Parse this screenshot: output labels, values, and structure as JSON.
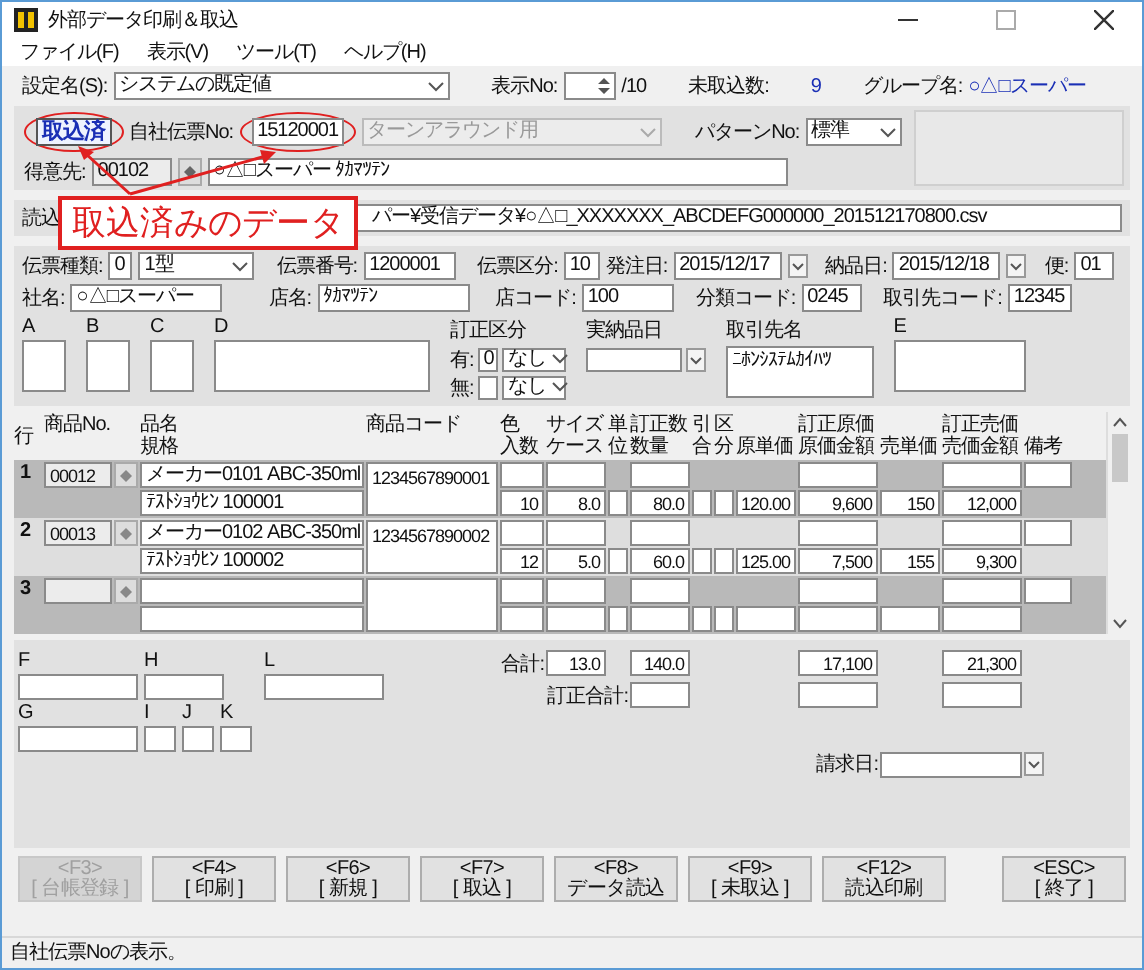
{
  "window": {
    "title": "外部データ印刷＆取込"
  },
  "menu": [
    {
      "label": "ファイル(F)"
    },
    {
      "label": "表示(V)"
    },
    {
      "label": "ツール(T)"
    },
    {
      "label": "ヘルプ(H)"
    }
  ],
  "settings": {
    "label": "設定名(S):",
    "value": "システムの既定値",
    "display_no_label": "表示No:",
    "display_no_total": "/10",
    "pending_label": "未取込数:",
    "pending_value": "9",
    "group_label": "グループ名:",
    "group_value": "○△□スーパー"
  },
  "slip": {
    "status_badge": "取込済",
    "own_no_label": "自社伝票No:",
    "own_no": "15120001",
    "turnaround": "ターンアラウンド用",
    "pattern_label": "パターンNo:",
    "pattern": "標準",
    "customer_label": "得意先:",
    "customer_code": "00102",
    "customer_name": "○△□スーパー ﾀｶﾏﾂﾃﾝ"
  },
  "annotation": {
    "text": "取込済みのデータ"
  },
  "read_file": {
    "label": "読込",
    "path": "パー¥受信データ¥○△□_XXXXXXX_ABCDEFG000000_201512170800.csv"
  },
  "header": {
    "slip_type_label": "伝票種類:",
    "slip_type_code": "0",
    "slip_type": "1型",
    "slip_no_label": "伝票番号:",
    "slip_no": "1200001",
    "slip_class_label": "伝票区分:",
    "slip_class": "10",
    "order_date_label": "発注日:",
    "order_date": "2015/12/17",
    "delivery_date_label": "納品日:",
    "delivery_date": "2015/12/18",
    "flight_label": "便:",
    "flight": "01",
    "company_label": "社名:",
    "company": "○△□スーパー",
    "store_label": "店名:",
    "store": "ﾀｶﾏﾂﾃﾝ",
    "store_code_label": "店コード:",
    "store_code": "100",
    "category_code_label": "分類コード:",
    "category_code": "0245",
    "supplier_code_label": "取引先コード:",
    "supplier_code": "12345"
  },
  "free_boxes": [
    {
      "label": "A",
      "kind": "small"
    },
    {
      "label": "B",
      "kind": "small"
    },
    {
      "label": "C",
      "kind": "small"
    },
    {
      "label": "D",
      "kind": "wide"
    }
  ],
  "correction": {
    "title": "訂正区分",
    "yes_label": "有:",
    "yes_code": "0",
    "yes_value": "なし",
    "no_label": "無:",
    "no_value": "なし"
  },
  "actual_delivery": {
    "title": "実納品日"
  },
  "supplier_name": {
    "title": "取引先名",
    "value": "ﾆﾎﾝｼｽﾃﾑｶｲﾊﾂ"
  },
  "box_e": {
    "label": "E"
  },
  "columns": {
    "line": "行",
    "product_no": "商品No.",
    "name": "品名",
    "spec": "規格",
    "code": "商品コード",
    "col_color": "色",
    "size": "サイズ",
    "pack": "入数",
    "case": "ケース",
    "unit": "単位",
    "corrected_qty": "訂正数",
    "qty": "数量",
    "hikiai": "引合",
    "kubun": "区分",
    "cost_unit": "原単価",
    "corrected_cost": "訂正原価",
    "cost_amount": "原価金額",
    "price_unit": "売単価",
    "corrected_price": "訂正売価",
    "price_amount": "売価金額",
    "note": "備考"
  },
  "rows": [
    {
      "line": "1",
      "product_no": "00012",
      "name": "メーカー0101 ABC-350ml",
      "spec": "ﾃｽﾄｼｮｳﾋﾝ 100001",
      "code": "1234567890001",
      "pack": "10",
      "case": "8.0",
      "qty": "80.0",
      "cost_unit": "120.00",
      "cost_amount": "9,600",
      "price_unit": "150",
      "price_amount": "12,000"
    },
    {
      "line": "2",
      "product_no": "00013",
      "name": "メーカー0102 ABC-350ml",
      "spec": "ﾃｽﾄｼｮｳﾋﾝ 100002",
      "code": "1234567890002",
      "pack": "12",
      "case": "5.0",
      "qty": "60.0",
      "cost_unit": "125.00",
      "cost_amount": "7,500",
      "price_unit": "155",
      "price_amount": "9,300"
    },
    {
      "line": "3"
    }
  ],
  "memo_top": [
    {
      "label": "F",
      "kind": "wide"
    },
    {
      "label": "H",
      "kind": "medium"
    }
  ],
  "memo_bottom": [
    {
      "label": "G",
      "kind": "wide"
    },
    {
      "label": "I",
      "kind": "small"
    },
    {
      "label": "J",
      "kind": "small"
    },
    {
      "label": "K",
      "kind": "small"
    }
  ],
  "memo_large": {
    "label": "L"
  },
  "totals": {
    "label": "合計:",
    "case": "13.0",
    "qty": "140.0",
    "cost": "17,100",
    "price": "21,300",
    "corrected_label": "訂正合計:"
  },
  "billing_date": {
    "label": "請求日:"
  },
  "buttons": [
    {
      "key": "<F3>",
      "label": "[ 台帳登録 ]",
      "disabled": true
    },
    {
      "key": "<F4>",
      "label": "[ 印刷 ]",
      "disabled": false
    },
    {
      "key": "<F6>",
      "label": "[ 新規 ]",
      "disabled": false
    },
    {
      "key": "<F7>",
      "label": "[ 取込 ]",
      "disabled": false
    },
    {
      "key": "<F8>",
      "label": "データ読込",
      "disabled": false
    },
    {
      "key": "<F9>",
      "label": "[ 未取込 ]",
      "disabled": false
    },
    {
      "key": "<F12>",
      "label": "読込印刷",
      "disabled": false
    }
  ],
  "exit_button": {
    "key": "<ESC>",
    "label": "[ 終了 ]"
  },
  "status_bar": "自社伝票Noの表示。"
}
